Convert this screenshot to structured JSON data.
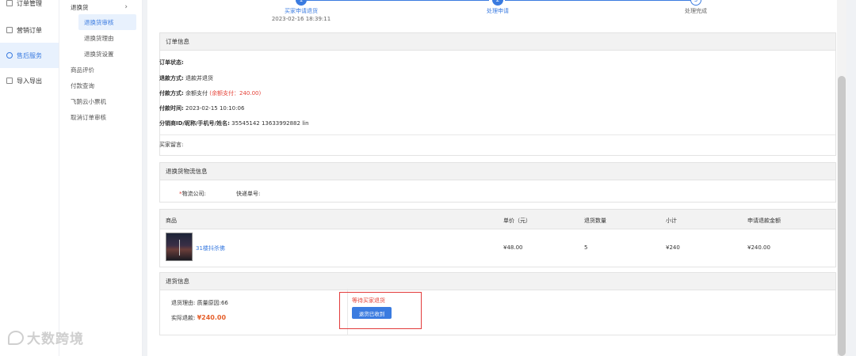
{
  "nav1": {
    "items": [
      {
        "label": "订单管理",
        "active": false
      },
      {
        "label": "营销订单",
        "active": false
      },
      {
        "label": "售后服务",
        "active": true
      },
      {
        "label": "导入导出",
        "active": false
      }
    ]
  },
  "nav2": {
    "group_label": "退换货",
    "sub_items": [
      "退换货审核",
      "退换货理由",
      "退换货设置"
    ],
    "items": [
      "商品评价",
      "付款查询",
      "飞鹅云小票机",
      "取消订单审核"
    ]
  },
  "steps": [
    {
      "num": "1",
      "label": "买家申请退货",
      "time": "2023-02-16 18:39:11"
    },
    {
      "num": "2",
      "label": "处理申请",
      "time": ""
    },
    {
      "num": "3",
      "label": "处理完成",
      "time": ""
    }
  ],
  "order_info": {
    "title": "订单信息",
    "status_label": "订单状态:",
    "refund_method_label": "退款方式:",
    "refund_method_value": "退款并退货",
    "payment_method_label": "付款方式:",
    "payment_method_value": "余额支付",
    "payment_method_note": "(余额支付：240.00)",
    "payment_time_label": "付款时间:",
    "payment_time_value": "2023-02-15 10:10:06",
    "distributor_label": "分销商ID/昵称/手机号/姓名:",
    "distributor_value": "35545142    13633992882  lin",
    "buyer_message_label": "买家留言:"
  },
  "logistics": {
    "title": "退换货物流信息",
    "required_mark": "*",
    "company_label": "物流公司:",
    "tracking_label": "快递单号:"
  },
  "table": {
    "headers": [
      "商品",
      "单价（元）",
      "退货数量",
      "小计",
      "申请退款金额"
    ],
    "row": {
      "product": "31楼抖杀佛",
      "price": "¥48.00",
      "qty": "5",
      "subtotal": "¥240",
      "refund": "¥240.00"
    }
  },
  "return_info": {
    "title": "退货信息",
    "reason_label": "退货理由:",
    "reason_value": "质量原因:66",
    "actual_refund_label": "实际退款:",
    "actual_refund_value": "¥240.00",
    "status_text": "等待买家退货",
    "confirm_button": "退货已收到"
  },
  "watermark": "大数跨境",
  "colors": {
    "accent": "#3a7be0",
    "warning": "#e5443a",
    "highlight_border": "#e23b3b"
  }
}
